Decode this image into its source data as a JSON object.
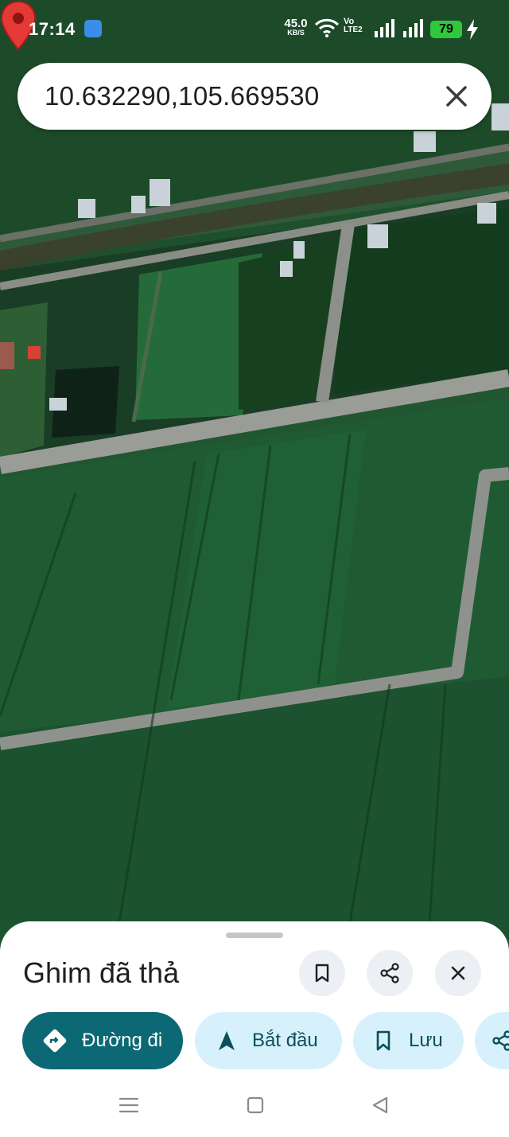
{
  "status_bar": {
    "time": "17:14",
    "net_speed_value": "45.0",
    "net_speed_unit": "KB/S",
    "volte_top": "Vo",
    "volte_bottom": "LTE2",
    "battery_level": "79"
  },
  "search": {
    "query": "10.632290,105.669530"
  },
  "map": {
    "type": "satellite",
    "pin_color": "#e53935"
  },
  "place_sheet": {
    "title": "Ghim đã thả",
    "actions": {
      "directions_label": "Đường đi",
      "start_label": "Bắt đầu",
      "save_label": "Lưu"
    }
  },
  "colors": {
    "primary_chip": "#0b6874",
    "secondary_chip": "#d6f1fb",
    "battery": "#2fc83c"
  }
}
